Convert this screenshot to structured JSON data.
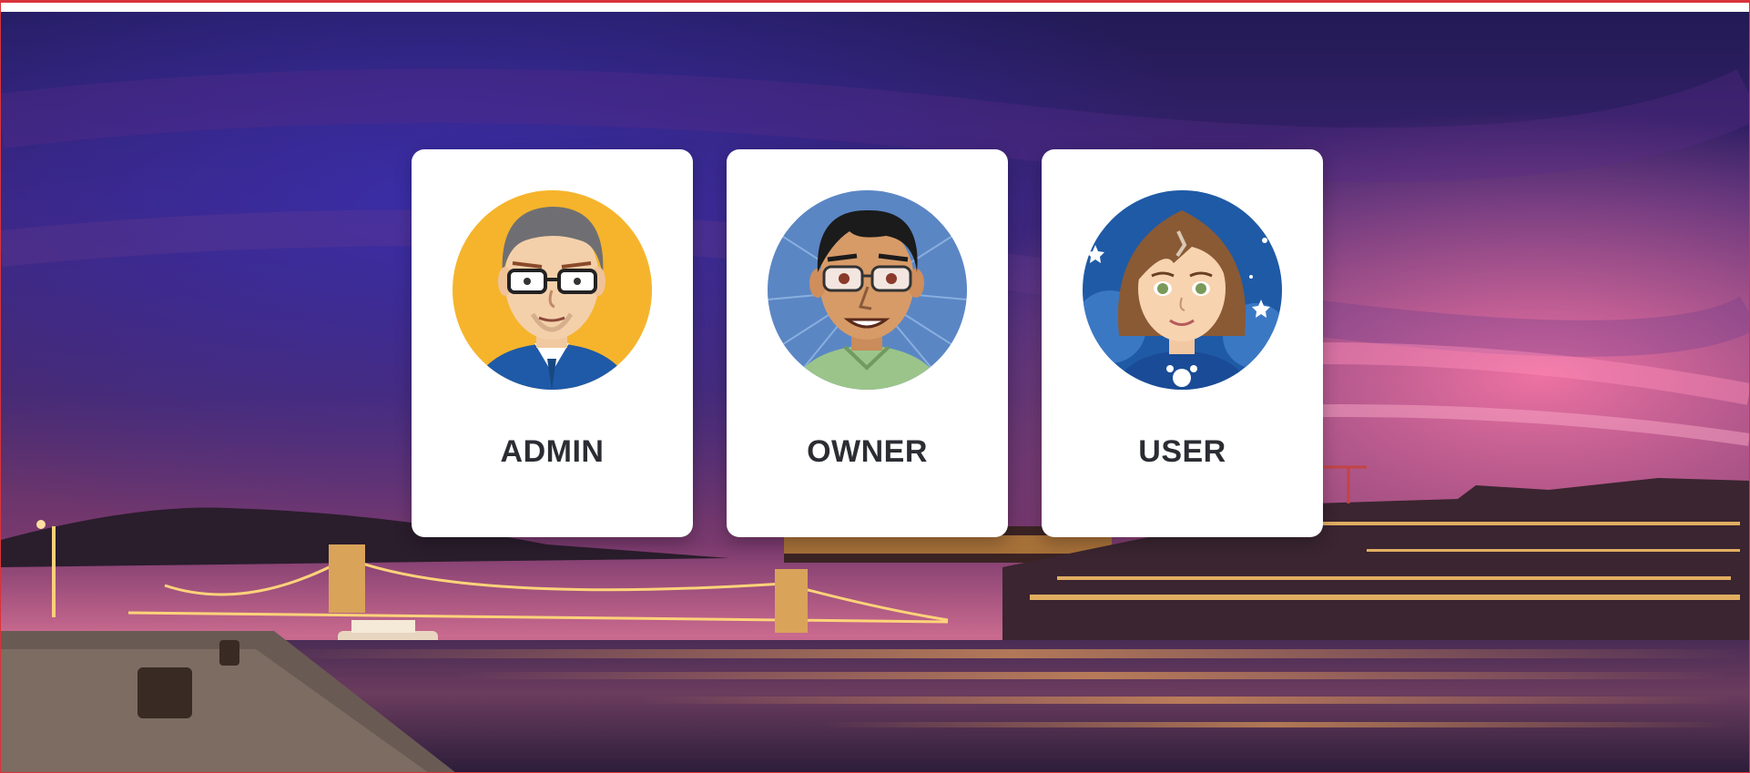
{
  "colors": {
    "frame_border": "#d8343a",
    "card_background": "#ffffff",
    "label_text": "#2b2d33",
    "sky_top": "#2a1c6e",
    "sky_horizon": "#e5628f",
    "city_lights": "#ffb347"
  },
  "background": {
    "icon": "night-city-river-photo"
  },
  "roles": [
    {
      "label": "ADMIN",
      "avatar_icon": "admin-avatar-icon",
      "avatar_bg": "#f6b42c"
    },
    {
      "label": "OWNER",
      "avatar_icon": "owner-avatar-icon",
      "avatar_bg": "#5b86c4"
    },
    {
      "label": "USER",
      "avatar_icon": "user-avatar-icon",
      "avatar_bg": "#1f5aa6"
    }
  ]
}
